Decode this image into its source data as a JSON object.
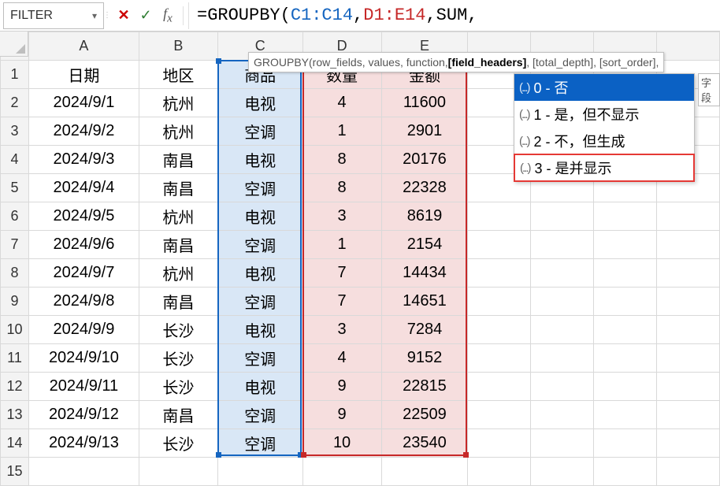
{
  "nameBox": {
    "value": "FILTER"
  },
  "formulaBar": {
    "prefix": "=",
    "fn": "GROUPBY",
    "open": "(",
    "arg1": "C1:C14",
    "sep": ",",
    "arg2": "D1:E14",
    "arg3": "SUM",
    "trailing": ","
  },
  "signatureTip": {
    "fn": "GROUPBY",
    "args_pre": "(row_fields, values, function, ",
    "bold": "[field_headers]",
    "args_post": ", [total_depth], [sort_order],"
  },
  "autocomplete": {
    "items": [
      {
        "label": "0 - 否",
        "selected": true,
        "highlight": false
      },
      {
        "label": "1 - 是，但不显示",
        "selected": false,
        "highlight": false
      },
      {
        "label": "2 - 不，但生成",
        "selected": false,
        "highlight": false
      },
      {
        "label": "3 - 是并显示",
        "selected": false,
        "highlight": true
      }
    ],
    "prefix_glyph": "(...)"
  },
  "markLabel": "字段",
  "columns": [
    "A",
    "B",
    "C",
    "D",
    "E"
  ],
  "headers": {
    "A": "日期",
    "B": "地区",
    "C": "商品",
    "D": "数量",
    "E": "金额"
  },
  "rows": [
    {
      "n": 1,
      "A": "日期",
      "B": "地区",
      "C": "商品",
      "D": "数量",
      "E": "金额"
    },
    {
      "n": 2,
      "A": "2024/9/1",
      "B": "杭州",
      "C": "电视",
      "D": "4",
      "E": "11600"
    },
    {
      "n": 3,
      "A": "2024/9/2",
      "B": "杭州",
      "C": "空调",
      "D": "1",
      "E": "2901"
    },
    {
      "n": 4,
      "A": "2024/9/3",
      "B": "南昌",
      "C": "电视",
      "D": "8",
      "E": "20176"
    },
    {
      "n": 5,
      "A": "2024/9/4",
      "B": "南昌",
      "C": "空调",
      "D": "8",
      "E": "22328"
    },
    {
      "n": 6,
      "A": "2024/9/5",
      "B": "杭州",
      "C": "电视",
      "D": "3",
      "E": "8619"
    },
    {
      "n": 7,
      "A": "2024/9/6",
      "B": "南昌",
      "C": "空调",
      "D": "1",
      "E": "2154"
    },
    {
      "n": 8,
      "A": "2024/9/7",
      "B": "杭州",
      "C": "电视",
      "D": "7",
      "E": "14434"
    },
    {
      "n": 9,
      "A": "2024/9/8",
      "B": "南昌",
      "C": "空调",
      "D": "7",
      "E": "14651"
    },
    {
      "n": 10,
      "A": "2024/9/9",
      "B": "长沙",
      "C": "电视",
      "D": "3",
      "E": "7284"
    },
    {
      "n": 11,
      "A": "2024/9/10",
      "B": "长沙",
      "C": "空调",
      "D": "4",
      "E": "9152"
    },
    {
      "n": 12,
      "A": "2024/9/11",
      "B": "长沙",
      "C": "电视",
      "D": "9",
      "E": "22815"
    },
    {
      "n": 13,
      "A": "2024/9/12",
      "B": "南昌",
      "C": "空调",
      "D": "9",
      "E": "22509"
    },
    {
      "n": 14,
      "A": "2024/9/13",
      "B": "长沙",
      "C": "空调",
      "D": "10",
      "E": "23540"
    },
    {
      "n": 15,
      "A": "",
      "B": "",
      "C": "",
      "D": "",
      "E": ""
    }
  ]
}
